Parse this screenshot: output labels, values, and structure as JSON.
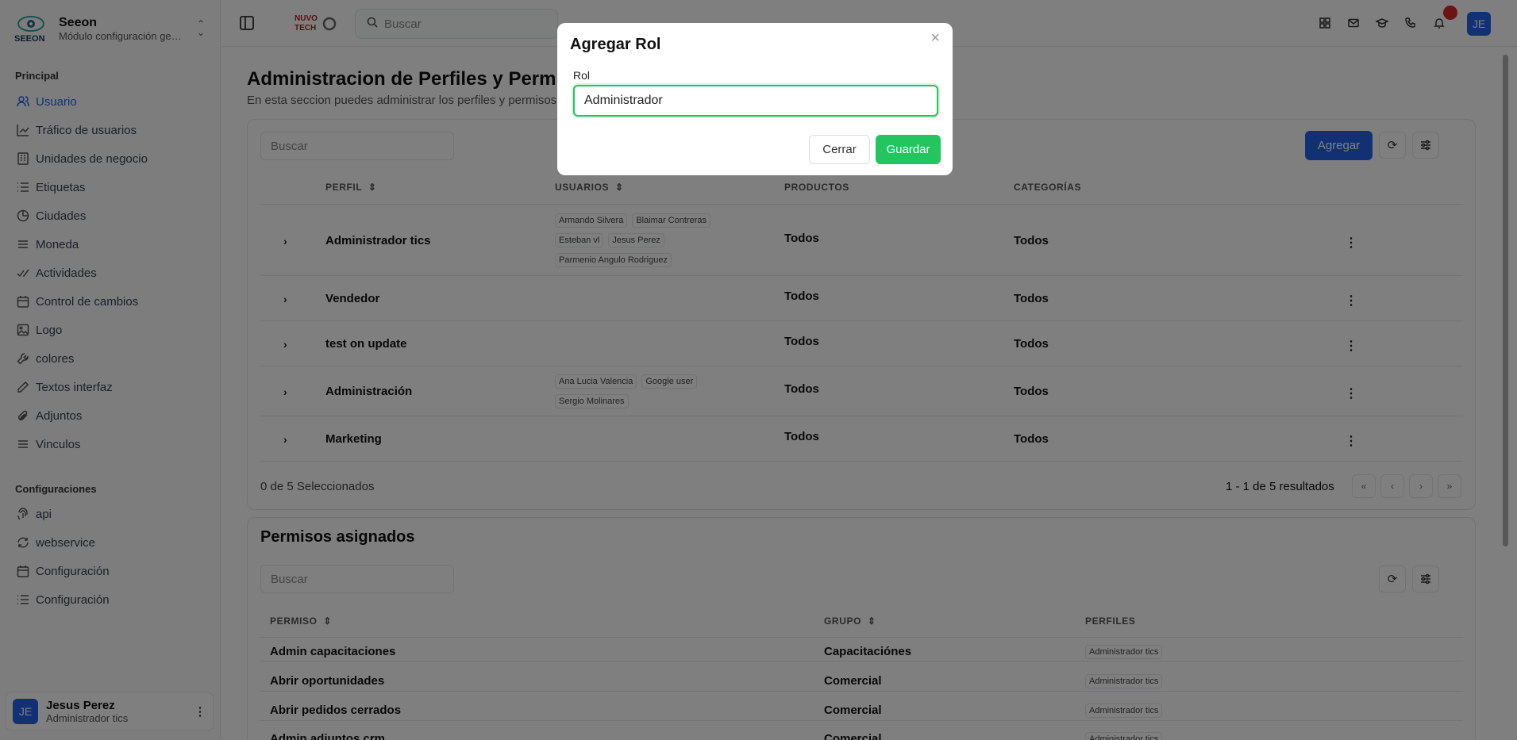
{
  "brand": {
    "title": "Seeon",
    "subtitle": "Módulo configuración general",
    "logo_text": "SEEON"
  },
  "sidebar": {
    "section1": "Principal",
    "items": [
      {
        "label": "Usuario",
        "icon": "users-icon",
        "active": true
      },
      {
        "label": "Tráfico de usuarios",
        "icon": "chart-line-icon"
      },
      {
        "label": "Unidades de negocio",
        "icon": "building-icon"
      },
      {
        "label": "Etiquetas",
        "icon": "list-icon"
      },
      {
        "label": "Ciudades",
        "icon": "pie-icon"
      },
      {
        "label": "Moneda",
        "icon": "money-icon"
      },
      {
        "label": "Actividades",
        "icon": "check-icon"
      },
      {
        "label": "Control de cambios",
        "icon": "calendar-icon"
      },
      {
        "label": "Logo",
        "icon": "image-icon"
      },
      {
        "label": "colores",
        "icon": "wrench-icon"
      },
      {
        "label": "Textos interfaz",
        "icon": "pen-icon"
      },
      {
        "label": "Adjuntos",
        "icon": "paperclip-icon"
      },
      {
        "label": "Vinculos",
        "icon": "link-icon"
      }
    ],
    "section2": "Configuraciones",
    "items2": [
      {
        "label": "api",
        "icon": "fingerprint-icon"
      },
      {
        "label": "webservice",
        "icon": "refresh-icon"
      },
      {
        "label": "Configuración",
        "icon": "calendar-icon"
      },
      {
        "label": "Configuración",
        "icon": "list-icon"
      }
    ],
    "user": {
      "initials": "JE",
      "name": "Jesus Perez",
      "role": "Administrador tics"
    }
  },
  "topbar": {
    "search_placeholder": "Buscar",
    "logo_text": "NUVO TECH",
    "avatar": "JE"
  },
  "page": {
    "title": "Administracion de Perfiles y Permisos",
    "subtitle": "En esta seccion puedes administrar los perfiles y permisos"
  },
  "profiles": {
    "search_placeholder": "Buscar",
    "add_label": "Agregar",
    "headers": [
      "PERFIL",
      "USUARIOS",
      "PRODUCTOS",
      "CATEGORÍAS"
    ],
    "rows": [
      {
        "perfil": "Administrador tics",
        "usuarios": [
          "Armando Silvera",
          "Blaimar Contreras",
          "Esteban vl",
          "Jesus Perez",
          "Parmenio Angulo Rodriguez"
        ],
        "productos": "Todos",
        "categorias": "Todos"
      },
      {
        "perfil": "Vendedor",
        "usuarios": [],
        "productos": "Todos",
        "categorias": "Todos"
      },
      {
        "perfil": "test on update",
        "usuarios": [],
        "productos": "Todos",
        "categorias": "Todos"
      },
      {
        "perfil": "Administración",
        "usuarios": [
          "Ana Lucia Valencia",
          "Google user",
          "Sergio Molinares"
        ],
        "productos": "Todos",
        "categorias": "Todos"
      },
      {
        "perfil": "Marketing",
        "usuarios": [],
        "productos": "Todos",
        "categorias": "Todos"
      }
    ],
    "selected": "0 de 5 Seleccionados",
    "results": "1 - 1 de 5 resultados"
  },
  "permisos": {
    "title": "Permisos asignados",
    "search_placeholder": "Buscar",
    "headers": [
      "PERMISO",
      "GRUPO",
      "PERFILES"
    ],
    "rows": [
      {
        "permiso": "Admin capacitaciones",
        "grupo": "Capacitaciónes",
        "perfil": "Administrador tics"
      },
      {
        "permiso": "Abrir oportunidades",
        "grupo": "Comercial",
        "perfil": "Administrador tics"
      },
      {
        "permiso": "Abrir pedidos cerrados",
        "grupo": "Comercial",
        "perfil": "Administrador tics"
      },
      {
        "permiso": "Admin adjuntos crm",
        "grupo": "Comercial",
        "perfil": "Administrador tics"
      }
    ]
  },
  "modal": {
    "title": "Agregar Rol",
    "label": "Rol",
    "value": "Administrador",
    "cancel": "Cerrar",
    "save": "Guardar",
    "close": "×"
  }
}
